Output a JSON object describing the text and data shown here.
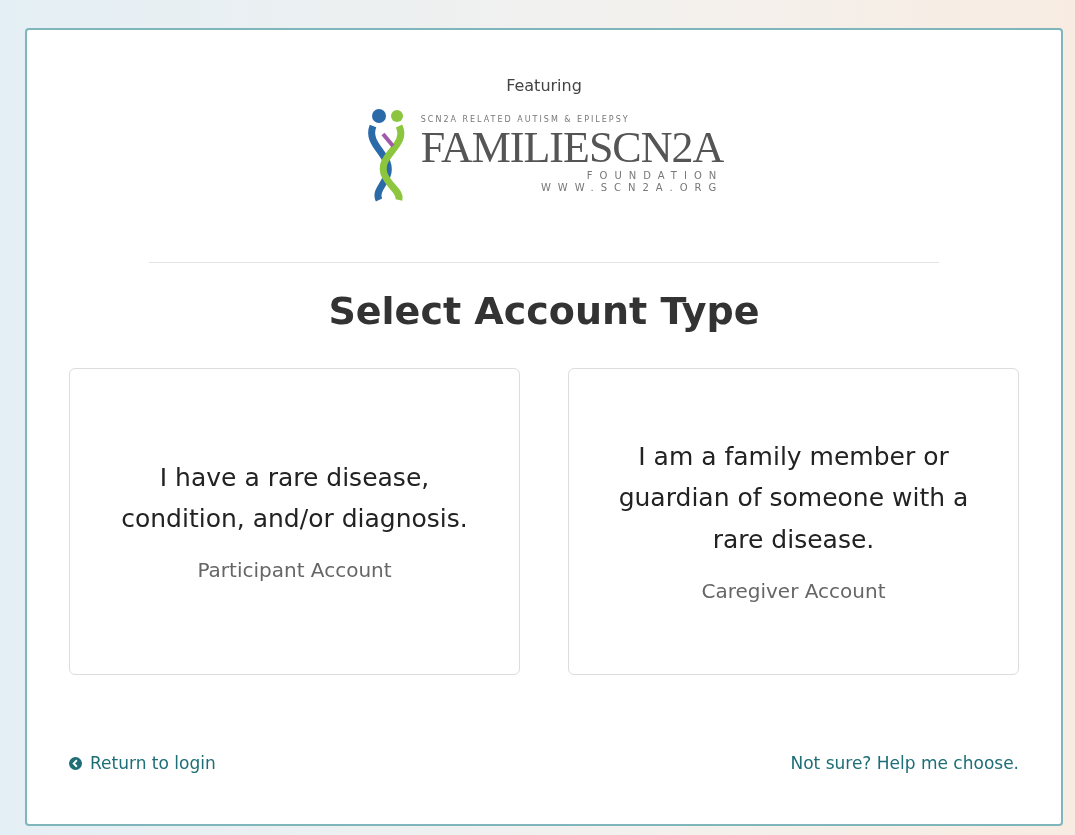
{
  "featuring": "Featuring",
  "logo": {
    "tagline": "SCN2A RELATED AUTISM & EPILEPSY",
    "name": "FAMILIESCN2A",
    "subtitle": "FOUNDATION",
    "website": "WWW.SCN2A.ORG"
  },
  "heading": "Select Account Type",
  "options": [
    {
      "description": "I have a rare disease, condition, and/or diagnosis.",
      "label": "Participant Account"
    },
    {
      "description": "I am a family member or guardian of someone with a rare disease.",
      "label": "Caregiver Account"
    }
  ],
  "footer": {
    "back_link": "Return to login",
    "help_link": "Not sure? Help me choose."
  }
}
